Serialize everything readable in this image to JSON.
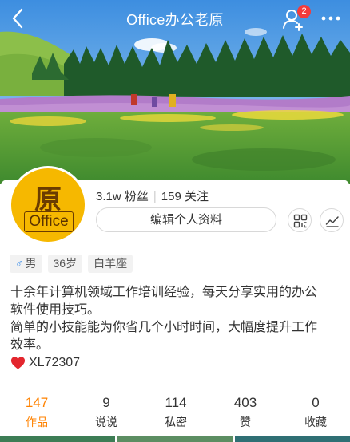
{
  "header": {
    "title": "Office办公老原",
    "notification_count": "2"
  },
  "avatar": {
    "char": "原",
    "word": "Office"
  },
  "profile": {
    "fans_count": "3.1w",
    "fans_label": "粉丝",
    "following_count": "159",
    "following_label": "关注",
    "edit_label": "编辑个人资料"
  },
  "tags": {
    "gender_symbol": "♂",
    "gender": "男",
    "age": "36岁",
    "zodiac": "白羊座"
  },
  "bio": {
    "line1": "十余年计算机领域工作培训经验，每天分享实用的办公",
    "line2": "软件使用技巧。",
    "line3": "简单的小技能能为你省几个小时时间，大幅度提升工作",
    "line4": "效率。",
    "id_text": "XL72307"
  },
  "stats": [
    {
      "value": "147",
      "label": "作品"
    },
    {
      "value": "9",
      "label": "说说"
    },
    {
      "value": "114",
      "label": "私密"
    },
    {
      "value": "403",
      "label": "赞"
    },
    {
      "value": "0",
      "label": "收藏"
    }
  ],
  "colors": {
    "accent": "#ff8200",
    "badge": "#f33b3b",
    "avatar_bg": "#f6b800"
  }
}
